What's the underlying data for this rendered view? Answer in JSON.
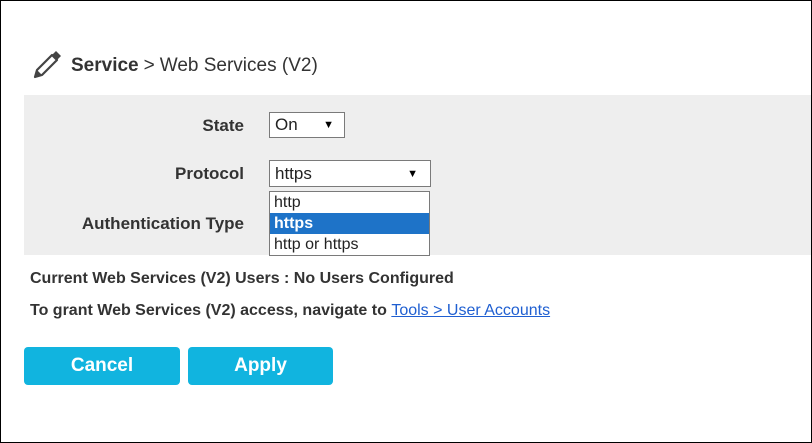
{
  "header": {
    "title": "Service",
    "separator": ">",
    "subtitle": "Web Services (V2)",
    "icon": "pencil-icon"
  },
  "form": {
    "state": {
      "label": "State",
      "value": "On"
    },
    "protocol": {
      "label": "Protocol",
      "value": "https",
      "options": [
        "http",
        "https",
        "http or https"
      ],
      "highlighted_option": "https"
    },
    "auth": {
      "label": "Authentication Type"
    }
  },
  "info": {
    "users_line": "Current Web Services (V2) Users : No Users Configured",
    "grant_text": "To grant Web Services (V2) access, navigate to",
    "grant_link": "Tools > User Accounts"
  },
  "buttons": {
    "cancel": "Cancel",
    "apply": "Apply"
  },
  "colors": {
    "button_bg": "#11b4df",
    "panel_bg": "#eeeeee",
    "selected_option_bg": "#1e73c8",
    "link": "#1f5fd1"
  }
}
